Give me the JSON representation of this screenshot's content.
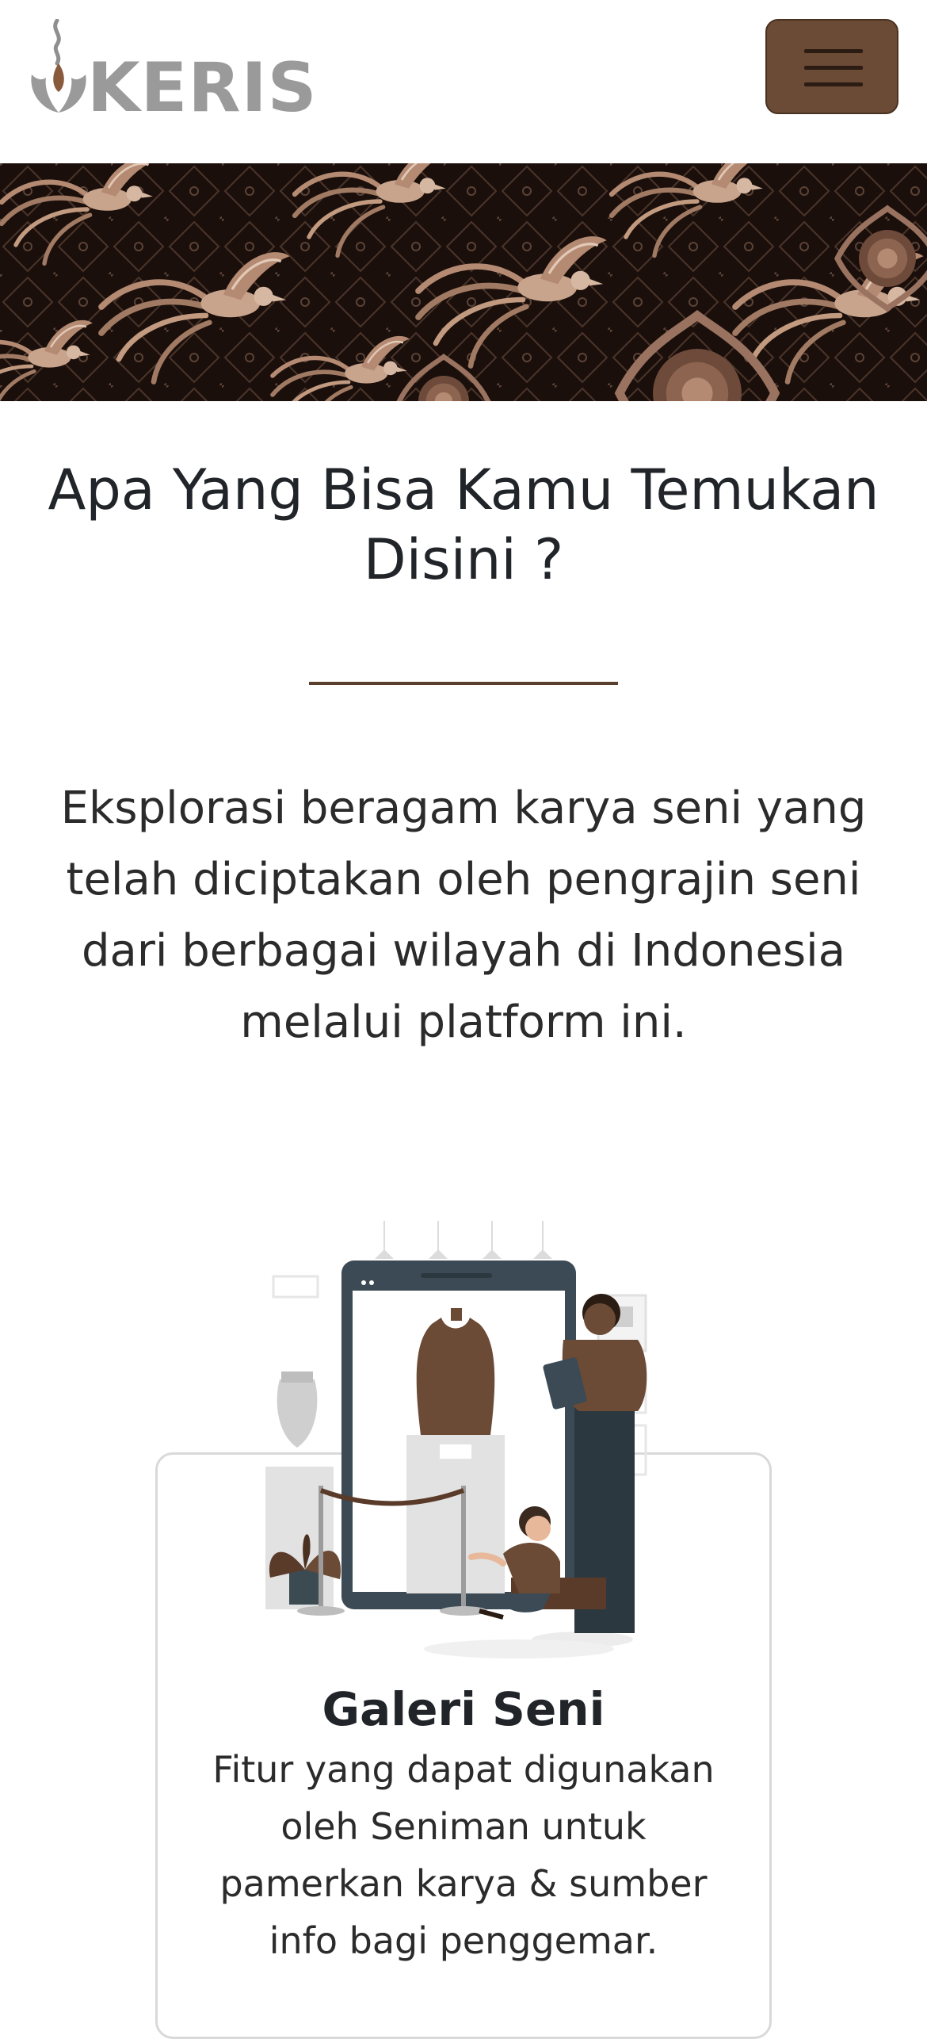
{
  "header": {
    "logo_text": "KERIS",
    "menu_icon": "hamburger-menu-icon"
  },
  "banner": {
    "pattern": "batik",
    "colors": {
      "background": "#1b0f0b",
      "motif": "#b48a72"
    }
  },
  "section": {
    "title": "Apa Yang Bisa Kamu Temukan Disini ?",
    "description": "Eksplorasi beragam karya seni yang telah diciptakan oleh pengrajin seni dari berbagai wilayah di Indonesia melalui platform ini."
  },
  "features": [
    {
      "title": "Galeri Seni",
      "description": "Fitur yang dapat digunakan oleh Seniman untuk pamerkan karya & sumber info bagi penggemar.",
      "illustration": "art-gallery-illustration"
    }
  ],
  "colors": {
    "accent": "#6b4a36",
    "divider": "#5b3f2d",
    "logo": "#9a9a9a"
  }
}
